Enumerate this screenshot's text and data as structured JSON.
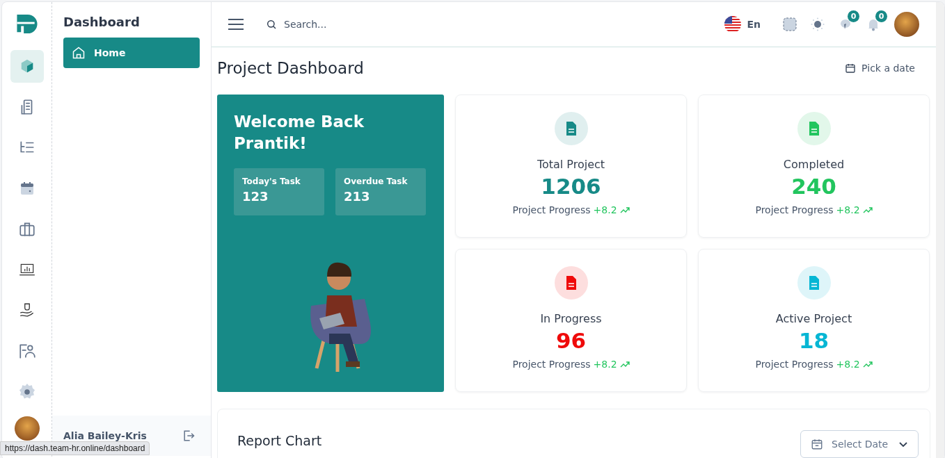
{
  "rail": [
    {
      "kind": "cube",
      "selected": true
    },
    {
      "kind": "building",
      "selected": false
    },
    {
      "kind": "list",
      "selected": false
    },
    {
      "kind": "calendar",
      "selected": false
    },
    {
      "kind": "briefcase",
      "selected": false
    },
    {
      "kind": "laptop-chart",
      "selected": false
    },
    {
      "kind": "hand-coin",
      "selected": false
    },
    {
      "kind": "person-board",
      "selected": false
    },
    {
      "kind": "gear",
      "selected": false
    }
  ],
  "sidebar": {
    "title": "Dashboard",
    "items": [
      {
        "label": "Home",
        "selected": true
      }
    ],
    "user": {
      "name": "Alia Bailey-Kris"
    }
  },
  "header": {
    "search": {
      "placeholder": "Search..."
    },
    "language": "En",
    "badges": [
      {
        "kind": "chat",
        "count": "0"
      },
      {
        "kind": "bell",
        "count": "0"
      }
    ]
  },
  "page": {
    "title": "Project Dashboard",
    "date_button": "Pick a date"
  },
  "welcome": {
    "title": "Welcome Back Prantik!",
    "tasks": [
      {
        "label": "Today's Task",
        "value": "123"
      },
      {
        "label": "Overdue Task",
        "value": "213"
      }
    ]
  },
  "stats": [
    {
      "title": "Total Project",
      "value": "1206",
      "color": "#178a87",
      "progress_label": "Project Progress",
      "delta": "+8.2"
    },
    {
      "title": "Completed",
      "value": "240",
      "color": "#22c55e",
      "progress_label": "Project Progress",
      "delta": "+8.2"
    },
    {
      "title": "In Progress",
      "value": "96",
      "color": "#ef0a0a",
      "progress_label": "Project Progress",
      "delta": "+8.2"
    },
    {
      "title": "Active Project",
      "value": "18",
      "color": "#06b6d4",
      "progress_label": "Project Progress",
      "delta": "+8.2"
    }
  ],
  "report": {
    "title": "Report Chart",
    "date_select": "Select Date"
  },
  "status_url": "https://dash.team-hr.online/dashboard"
}
